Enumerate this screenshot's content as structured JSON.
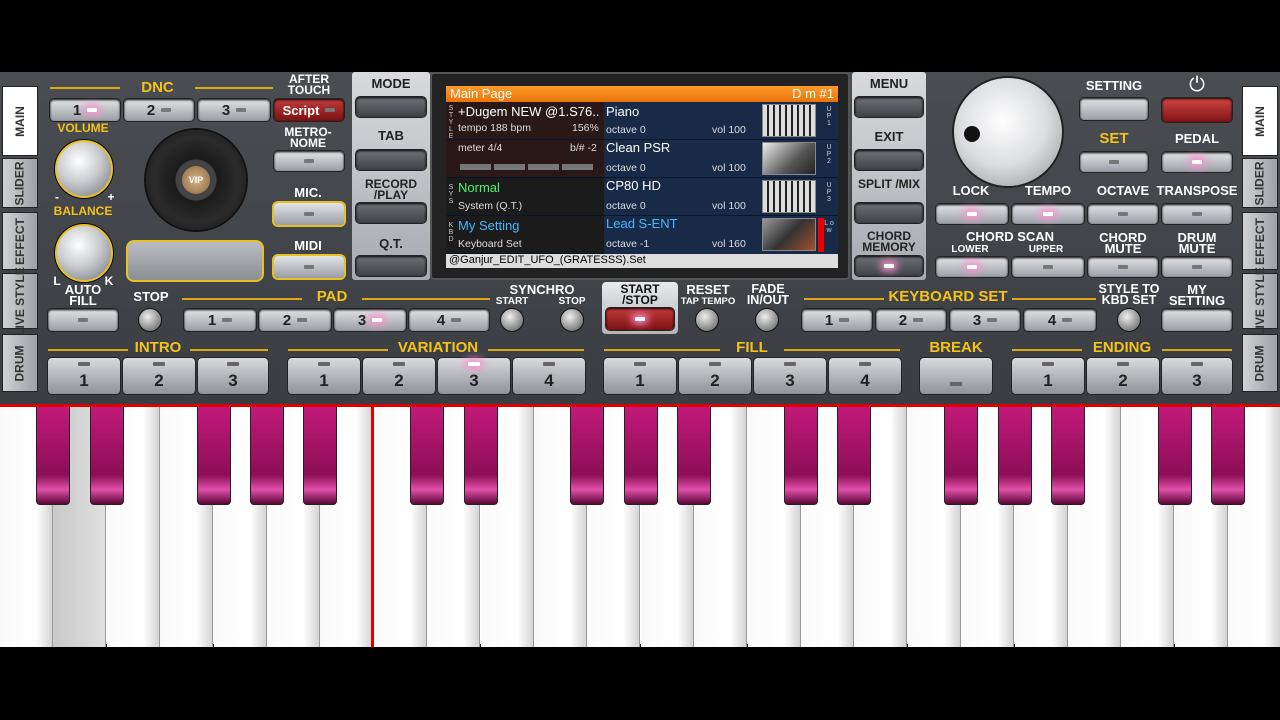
{
  "side_tabs_left": [
    "MAIN",
    "SLIDER",
    "EFFECT",
    "LIVE STYLE",
    "DRUM"
  ],
  "side_tabs_right": [
    "MAIN",
    "SLIDER",
    "EFFECT",
    "LIVE STYLE",
    "DRUM"
  ],
  "dnc": {
    "label": "DNC",
    "buttons": [
      "1",
      "2",
      "3"
    ],
    "after_touch": "AFTER TOUCH",
    "script": "Script"
  },
  "knobs": {
    "volume": "VOLUME",
    "balance": "BALANCE",
    "minus": "-",
    "plus": "+",
    "l": "L",
    "k": "K"
  },
  "logo_text": "VIP",
  "left_labels": {
    "metronome": "METRO- NOME",
    "mic": "MIC.",
    "midi": "MIDI"
  },
  "mid_buttons": {
    "mode": "MODE",
    "tab": "TAB",
    "record_play": "RECORD /PLAY",
    "qt": "Q.T."
  },
  "right_buttons": {
    "menu": "MENU",
    "exit": "EXIT",
    "split_mix": "SPLIT /MIX",
    "chord_memory": "CHORD MEMORY"
  },
  "screen": {
    "title": "Main Page",
    "chord": "D m #1",
    "style_name": "+Dugem NEW @1.S76..",
    "tempo": "tempo 188 bpm",
    "tempo_pct": "156%",
    "meter": "meter 4/4",
    "transpose": "b/# -2",
    "system_name": "Normal",
    "system_sub": "System (Q.T.)",
    "kbd_name": "My Setting",
    "kbd_sub": "Keyboard Set",
    "tag_style": "S T Y L E",
    "tag_sys": "S Y S",
    "tag_kbd": "K B D",
    "voices": [
      {
        "name": "Piano",
        "octave": "octave 0",
        "vol": "vol 100",
        "tag": "U P 1"
      },
      {
        "name": "Clean PSR",
        "octave": "octave 0",
        "vol": "vol 100",
        "tag": "U P 2"
      },
      {
        "name": "CP80 HD",
        "octave": "octave 0",
        "vol": "vol 100",
        "tag": "U P 3"
      },
      {
        "name": "Lead S-ENT",
        "octave": "octave -1",
        "vol": "vol 160",
        "tag": "L o w"
      }
    ],
    "footer": "@Ganjur_EDIT_UFO_(GRATESSS).Set"
  },
  "top_right": {
    "setting": "SETTING",
    "set": "SET",
    "pedal": "PEDAL",
    "lock": "LOCK",
    "tempo": "TEMPO",
    "octave": "OCTAVE",
    "transpose": "TRANSPOSE",
    "chord_scan": "CHORD SCAN",
    "lower": "LOWER",
    "upper": "UPPER",
    "chord_mute": "CHORD MUTE",
    "drum_mute": "DRUM MUTE"
  },
  "row2": {
    "auto_fill": "AUTO FILL",
    "stop": "STOP",
    "pad": "PAD",
    "pad_buttons": [
      "1",
      "2",
      "3",
      "4"
    ],
    "synchro": "SYNCHRO",
    "sync_start": "START",
    "sync_stop": "STOP",
    "start_stop": "START /STOP",
    "reset": "RESET",
    "tap_tempo": "TAP TEMPO",
    "fade": "FADE IN/OUT",
    "keyboard_set": "KEYBOARD SET",
    "kbd_buttons": [
      "1",
      "2",
      "3",
      "4"
    ],
    "style_to_kbd": "STYLE TO KBD SET",
    "my_setting": "MY SETTING"
  },
  "row3": {
    "intro": "INTRO",
    "intro_buttons": [
      "1",
      "2",
      "3"
    ],
    "variation": "VARIATION",
    "variation_buttons": [
      "1",
      "2",
      "3",
      "4"
    ],
    "fill": "FILL",
    "fill_buttons": [
      "1",
      "2",
      "3",
      "4"
    ],
    "break": "BREAK",
    "ending": "ENDING",
    "ending_buttons": [
      "1",
      "2",
      "3"
    ]
  },
  "colors": {
    "accent_yellow": "#f4c21a",
    "key_black": "#b0156e",
    "led": "#ff8fd0",
    "screen_header": "#ff8a1a"
  }
}
